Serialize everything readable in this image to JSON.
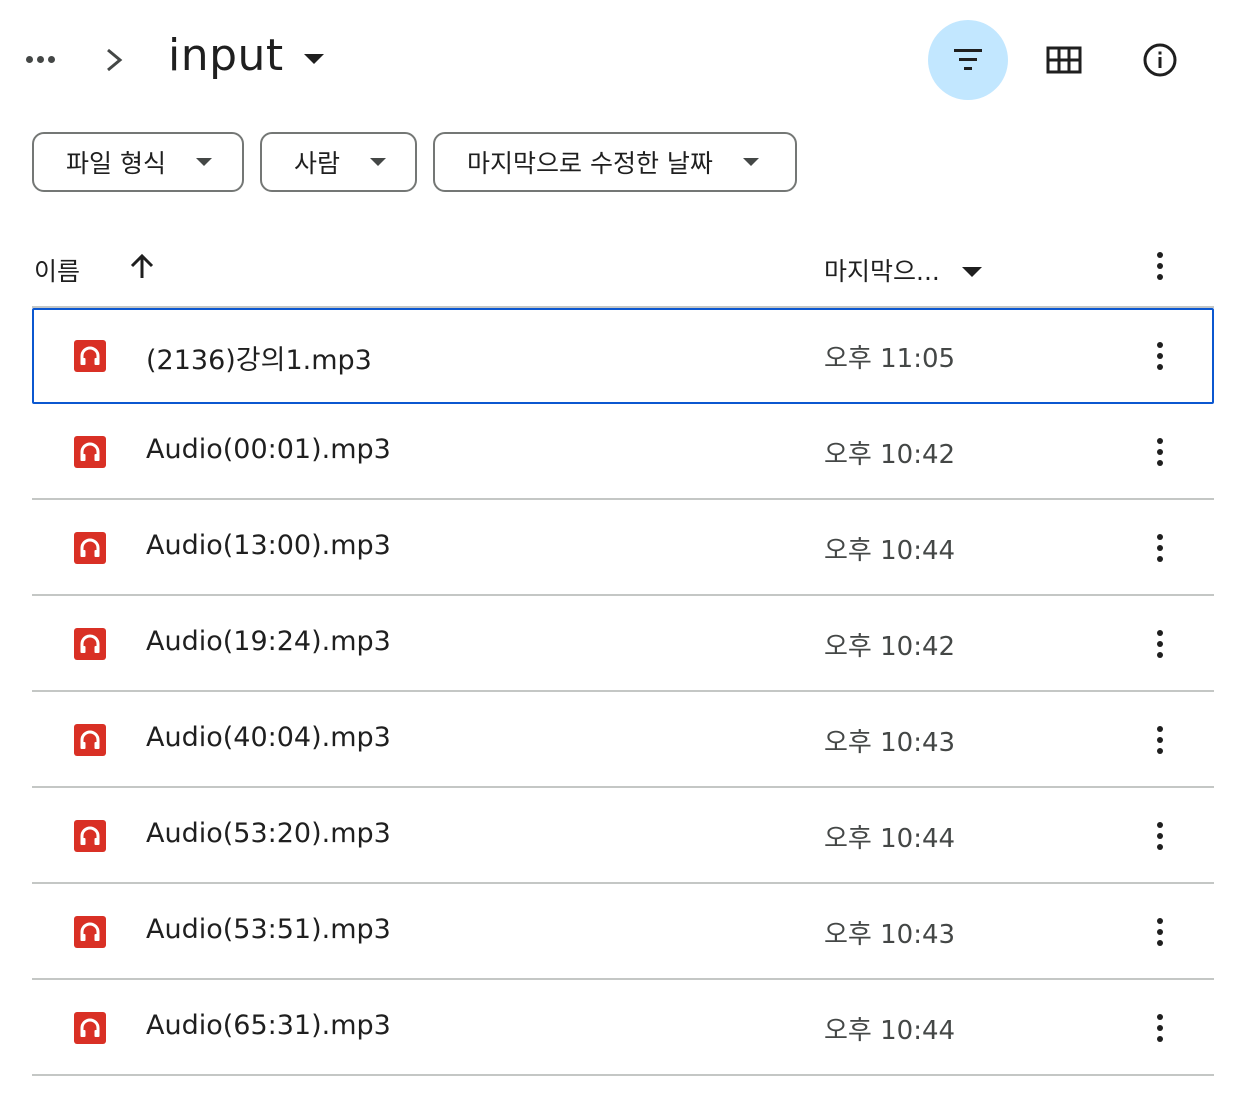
{
  "header": {
    "folder_name": "input",
    "icons": {
      "more": "more-horiz-icon",
      "breadcrumb_separator": "chevron-right-icon",
      "filter": "filter-list-icon",
      "grid_view": "grid-view-icon",
      "info": "info-icon"
    },
    "filter_active_bg": "#c2e7ff"
  },
  "filters": {
    "type_label": "파일 형식",
    "people_label": "사람",
    "modified_label": "마지막으로 수정한 날짜"
  },
  "columns": {
    "name": "이름",
    "modified": "마지막으..."
  },
  "files": [
    {
      "name": "(2136)강의1.mp3",
      "modified": "오후 11:05",
      "icon": "audio-file-icon"
    },
    {
      "name": "Audio(00:01).mp3",
      "modified": "오후 10:42",
      "icon": "audio-file-icon"
    },
    {
      "name": "Audio(13:00).mp3",
      "modified": "오후 10:44",
      "icon": "audio-file-icon"
    },
    {
      "name": "Audio(19:24).mp3",
      "modified": "오후 10:42",
      "icon": "audio-file-icon"
    },
    {
      "name": "Audio(40:04).mp3",
      "modified": "오후 10:43",
      "icon": "audio-file-icon"
    },
    {
      "name": "Audio(53:20).mp3",
      "modified": "오후 10:44",
      "icon": "audio-file-icon"
    },
    {
      "name": "Audio(53:51).mp3",
      "modified": "오후 10:43",
      "icon": "audio-file-icon"
    },
    {
      "name": "Audio(65:31).mp3",
      "modified": "오후 10:44",
      "icon": "audio-file-icon"
    }
  ],
  "colors": {
    "audio_icon": "#d93025",
    "selection_border": "#0b57d0",
    "divider": "#c4c7c5"
  }
}
